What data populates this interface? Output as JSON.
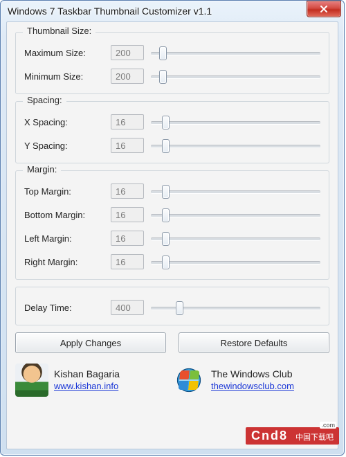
{
  "title": "Windows 7 Taskbar Thumbnail Customizer v1.1",
  "groups": {
    "thumb": {
      "legend": "Thumbnail Size:",
      "max": {
        "label": "Maximum Size:",
        "value": "200",
        "pos": 12
      },
      "min": {
        "label": "Minimum Size:",
        "value": "200",
        "pos": 12
      }
    },
    "spacing": {
      "legend": "Spacing:",
      "x": {
        "label": "X Spacing:",
        "value": "16",
        "pos": 16
      },
      "y": {
        "label": "Y Spacing:",
        "value": "16",
        "pos": 16
      }
    },
    "margin": {
      "legend": "Margin:",
      "top": {
        "label": "Top Margin:",
        "value": "16",
        "pos": 16
      },
      "bottom": {
        "label": "Bottom Margin:",
        "value": "16",
        "pos": 16
      },
      "left": {
        "label": "Left Margin:",
        "value": "16",
        "pos": 16
      },
      "right": {
        "label": "Right Margin:",
        "value": "16",
        "pos": 16
      }
    },
    "delay": {
      "label": "Delay Time:",
      "value": "400",
      "pos": 36
    }
  },
  "buttons": {
    "apply": "Apply Changes",
    "restore": "Restore Defaults"
  },
  "credits": {
    "left": {
      "name": "Kishan Bagaria",
      "link": "www.kishan.info"
    },
    "right": {
      "name": "The Windows Club",
      "link": "thewindowsclub.com"
    }
  },
  "watermark": {
    "main": "Cnd8",
    "sub": ".com",
    "cn": "中国下载吧"
  }
}
